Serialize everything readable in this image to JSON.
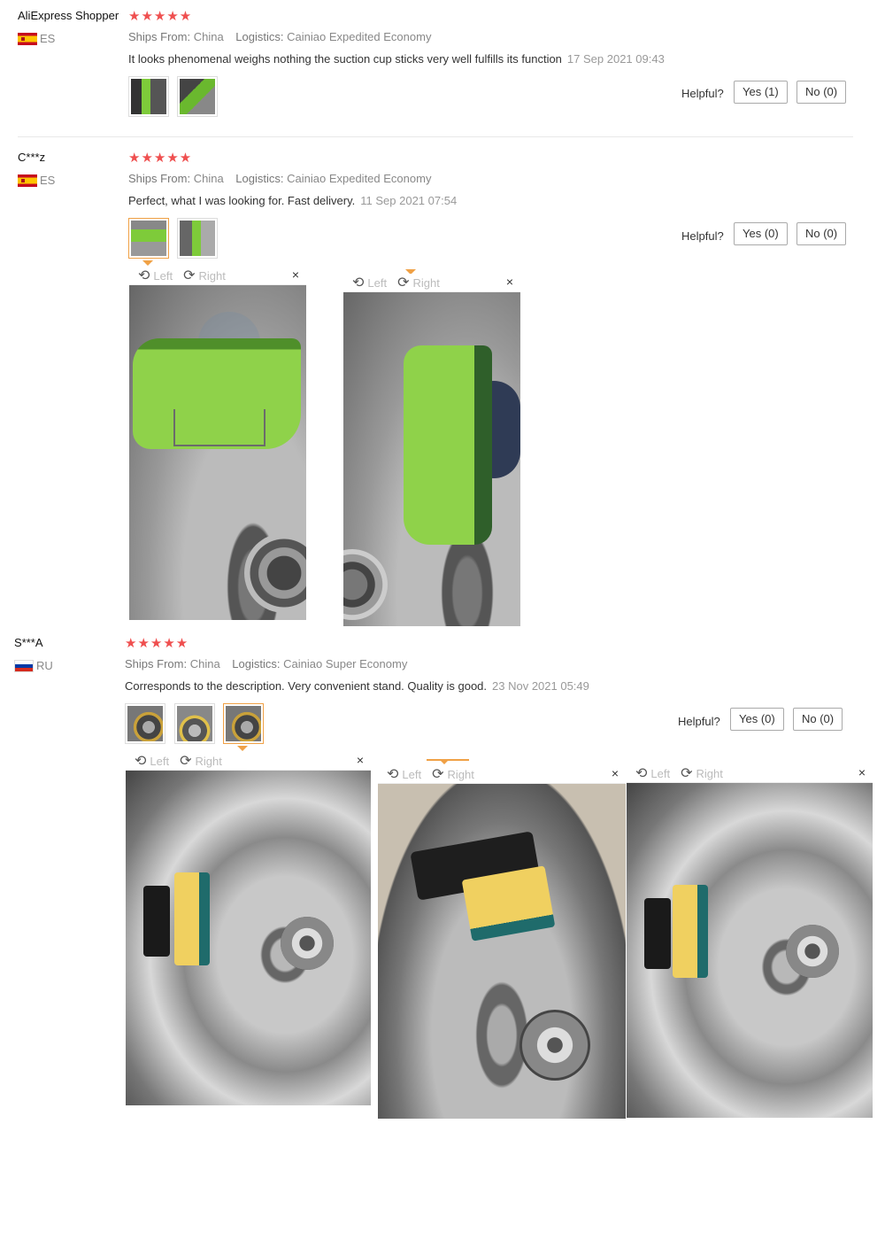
{
  "reviews": [
    {
      "name": "AliExpress Shopper",
      "country": "ES",
      "stars": "★★★★★",
      "ships_label": "Ships From:",
      "ships_value": "China",
      "logistics_label": "Logistics:",
      "logistics_value": "Cainiao Expedited Economy",
      "text": "It looks phenomenal weighs nothing the suction cup sticks very well fulfills its function",
      "date": "17 Sep 2021 09:43",
      "helpful_label": "Helpful?",
      "yes_label": "Yes (1)",
      "no_label": "No (0)"
    },
    {
      "name": "C***z",
      "country": "ES",
      "stars": "★★★★★",
      "ships_label": "Ships From:",
      "ships_value": "China",
      "logistics_label": "Logistics:",
      "logistics_value": "Cainiao Expedited Economy",
      "text": "Perfect, what I was looking for. Fast delivery.",
      "date": "11 Sep 2021 07:54",
      "helpful_label": "Helpful?",
      "yes_label": "Yes (0)",
      "no_label": "No (0)"
    },
    {
      "name": "S***A",
      "country": "RU",
      "stars": "★★★★★",
      "ships_label": "Ships From:",
      "ships_value": "China",
      "logistics_label": "Logistics:",
      "logistics_value": "Cainiao Super Economy",
      "text": "Corresponds to the description. Very convenient stand. Quality is good.",
      "date": "23 Nov 2021 05:49",
      "helpful_label": "Helpful?",
      "yes_label": "Yes (0)",
      "no_label": "No (0)"
    }
  ],
  "viewer": {
    "left_label": "Left",
    "right_label": "Right",
    "close_glyph": "×"
  },
  "colors": {
    "star": "#ef4f4f",
    "accent": "#f0a146"
  }
}
